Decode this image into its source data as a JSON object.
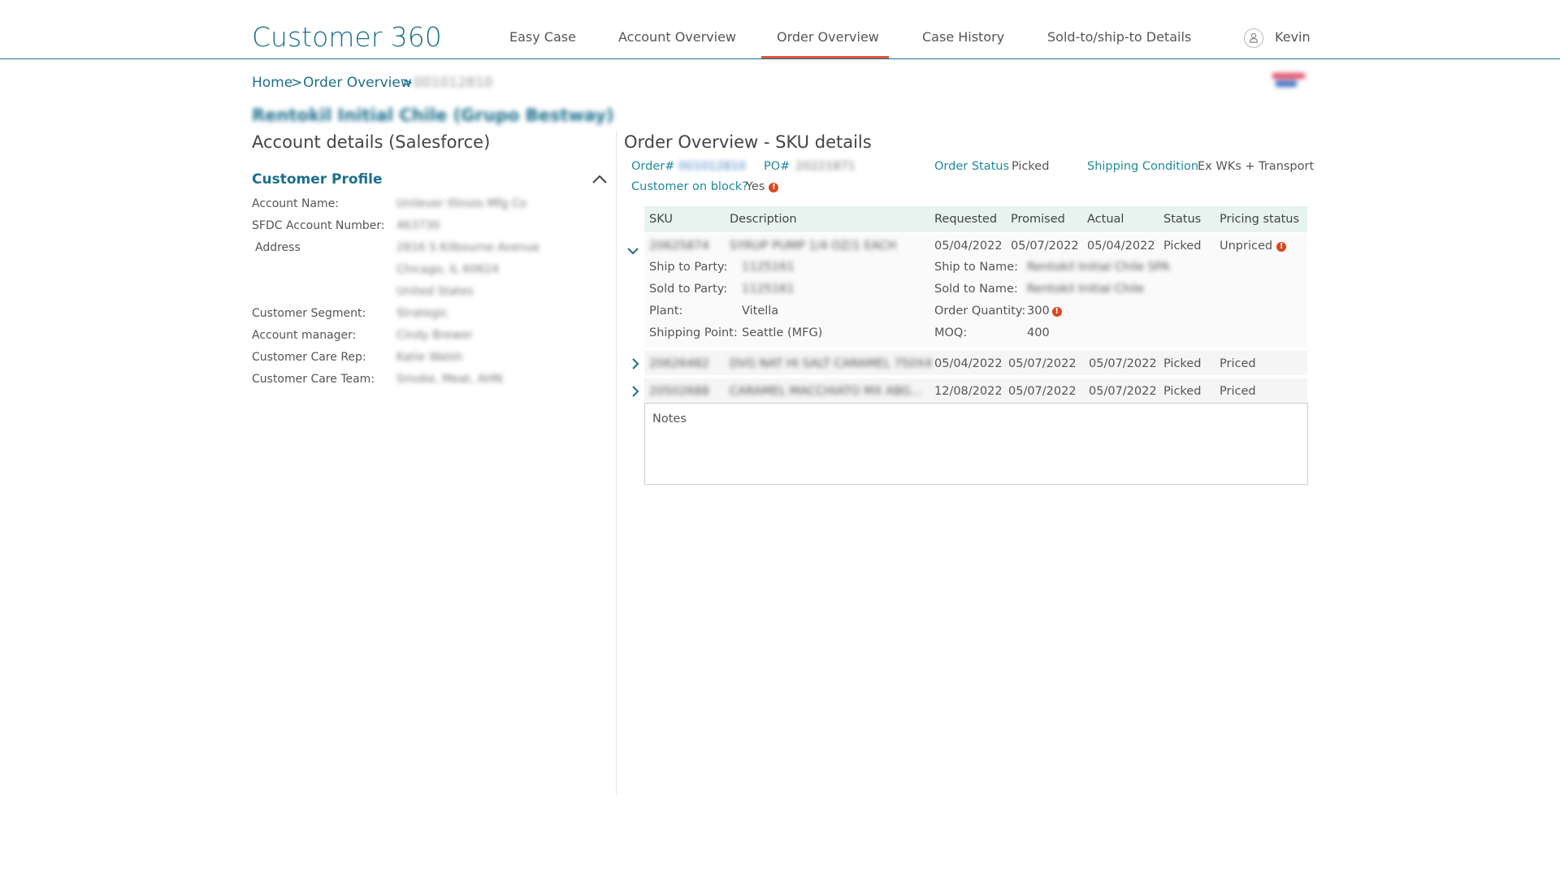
{
  "header": {
    "brand": "Customer 360",
    "nav": [
      "Easy Case",
      "Account Overview",
      "Order Overview",
      "Case History",
      "Sold-to/ship-to Details"
    ],
    "active_tab": "Order Overview",
    "user": "Kevin"
  },
  "breadcrumb": {
    "home": "Home",
    "sep1": ">",
    "section": "Order Overview",
    "sep2": ">",
    "current": "001012810"
  },
  "account_name": "Rentokil Initial Chile (Grupo Bestway)",
  "left": {
    "title": "Account details (Salesforce)",
    "profile_title": "Customer Profile",
    "fields": [
      {
        "label": "Account Name:",
        "value": "Unilever Illinois Mfg Co"
      },
      {
        "label": "SFDC Account Number:",
        "value": "463730"
      },
      {
        "label": "Address",
        "value": "2816 S Kilbourne Avenue"
      },
      {
        "label": "",
        "value": "Chicago, IL 60624"
      },
      {
        "label": "",
        "value": "United States"
      },
      {
        "label": "Customer Segment:",
        "value": "Strategic"
      },
      {
        "label": "Account manager:",
        "value": "Cindy Brewer"
      },
      {
        "label": "Customer Care Rep:",
        "value": "Katie Walsh"
      },
      {
        "label": "Customer Care Team:",
        "value": "Smoke, Meat, AHN"
      }
    ]
  },
  "right": {
    "title": "Order Overview - SKU details",
    "order_label": "Order#",
    "order_value": "001012810",
    "po_label": "PO#",
    "po_value": "20221871",
    "order_status_label": "Order Status",
    "order_status_value": "Picked",
    "shipping_condition_label": "Shipping Condition",
    "shipping_condition_value": "Ex WKs + Transport",
    "block_label": "Customer on block?",
    "block_value": "Yes"
  },
  "table": {
    "columns": [
      "SKU",
      "Description",
      "Requested",
      "Promised",
      "Actual",
      "Status",
      "Pricing status"
    ],
    "rows": [
      {
        "sku": "20625874",
        "description": "SYRUP PUMP 1/4 OZ/1 EACH",
        "requested": "05/04/2022",
        "promised": "05/07/2022",
        "actual": "05/04/2022",
        "status": "Picked",
        "pricing": "Unpriced"
      },
      {
        "sku": "20626482",
        "description": "DVG NAT HI SALT CARAMEL 750X4",
        "requested": "05/04/2022",
        "promised": "05/07/2022",
        "actual": "05/07/2022",
        "status": "Picked",
        "pricing": "Priced"
      },
      {
        "sku": "20502688",
        "description": "CARAMEL MACCHIATO MX ABG...",
        "requested": "12/08/2022",
        "promised": "05/07/2022",
        "actual": "05/07/2022",
        "status": "Picked",
        "pricing": "Priced"
      }
    ],
    "expanded": {
      "ship_to_party_label": "Ship to Party:",
      "ship_to_party_value": "1125161",
      "sold_to_party_label": "Sold to Party:",
      "sold_to_party_value": "1125161",
      "plant_label": "Plant:",
      "plant_value": "Vitella",
      "shipping_point_label": "Shipping  Point:",
      "shipping_point_value": "Seattle (MFG)",
      "ship_to_name_label": "Ship to Name:",
      "ship_to_name_value": "Rentokil Initial Chile SPA",
      "sold_to_name_label": "Sold to Name:",
      "sold_to_name_value": "Rentokil Initial Chile",
      "order_qty_label": "Order Quantity:",
      "order_qty_value": "300",
      "moq_label": "MOQ:",
      "moq_value": "400"
    }
  },
  "notes_label": "Notes",
  "colors": {
    "accent": "#1d6f8c",
    "active_underline": "#e0533b",
    "warning": "#d9481f",
    "table_header": "#e6f3ee"
  }
}
